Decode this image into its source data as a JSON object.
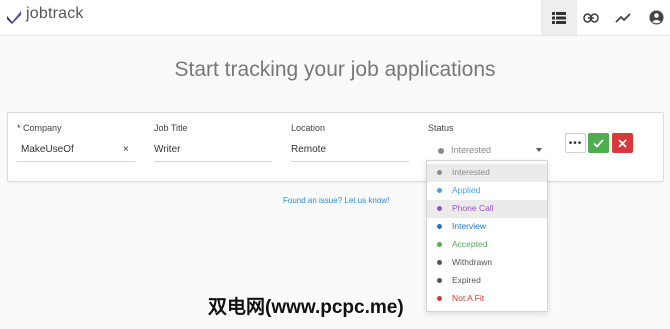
{
  "app": {
    "brand": "jobtrack"
  },
  "nav": {
    "icons": [
      "list-icon",
      "link-icon",
      "trend-icon",
      "account-icon"
    ]
  },
  "main": {
    "headline": "Start tracking your job applications"
  },
  "form": {
    "company": {
      "required_mark": "*",
      "label": "Company",
      "value": "MakeUseOf",
      "clear": "×"
    },
    "job_title": {
      "label": "Job Title",
      "value": "Writer"
    },
    "location": {
      "label": "Location",
      "value": "Remote"
    },
    "status": {
      "label": "Status",
      "value": "Interested",
      "color": "#8a8a8a"
    },
    "more_label": "•••"
  },
  "status_options": [
    {
      "label": "Interested",
      "color": "#8a8a8a",
      "dot": "#8a8a8a",
      "highlight": true
    },
    {
      "label": "Applied",
      "color": "#4aa3df",
      "dot": "#4aa3df",
      "highlight": false
    },
    {
      "label": "Phone Call",
      "color": "#9b51c7",
      "dot": "#9b51c7",
      "highlight": true
    },
    {
      "label": "Interview",
      "color": "#1f78c8",
      "dot": "#1f78c8",
      "highlight": false
    },
    {
      "label": "Accepted",
      "color": "#4caf50",
      "dot": "#4caf50",
      "highlight": false
    },
    {
      "label": "Withdrawn",
      "color": "#555555",
      "dot": "#555555",
      "highlight": false
    },
    {
      "label": "Expired",
      "color": "#555555",
      "dot": "#555555",
      "highlight": false
    },
    {
      "label": "Not A Fit",
      "color": "#d9393b",
      "dot": "#d9393b",
      "highlight": false
    }
  ],
  "footer": {
    "issue_link": "Found an issue? Let us know!"
  },
  "watermark": "双电网(www.pcpc.me)"
}
